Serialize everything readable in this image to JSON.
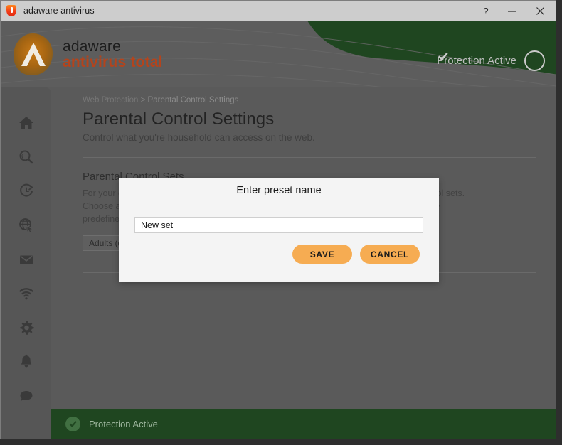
{
  "window": {
    "title": "adaware antivirus",
    "app_icon": "shield-icon",
    "controls": [
      {
        "name": "help-button",
        "glyph": "?"
      },
      {
        "name": "minimize-button",
        "glyph": "—"
      },
      {
        "name": "close-button",
        "glyph": "✕"
      }
    ]
  },
  "header": {
    "logo_top": "adaware",
    "logo_bottom": "antivirus total",
    "protection_label": "Protection Active",
    "protection_icon": "check-circle-icon",
    "green": "#1f4620"
  },
  "sidebar": {
    "items": [
      {
        "name": "sidebar-item-home",
        "icon": "home-icon"
      },
      {
        "name": "sidebar-item-scan",
        "icon": "search-icon"
      },
      {
        "name": "sidebar-item-history",
        "icon": "clock-history-icon"
      },
      {
        "name": "sidebar-item-web-protection",
        "icon": "globe-cursor-icon"
      },
      {
        "name": "sidebar-item-email",
        "icon": "envelope-icon"
      },
      {
        "name": "sidebar-item-network",
        "icon": "wifi-icon"
      },
      {
        "name": "sidebar-item-settings",
        "icon": "gear-icon"
      },
      {
        "name": "sidebar-item-notifications",
        "icon": "bell-icon"
      },
      {
        "name": "sidebar-item-support",
        "icon": "chat-bubble-icon"
      }
    ]
  },
  "breadcrumb": {
    "parent": "Web Protection",
    "separator": ">",
    "current": "Parental Control Settings"
  },
  "page": {
    "title": "Parental Control Settings",
    "subtitle": "Control what you're household can access on the web.",
    "section_title": "Parental Control Sets",
    "section_body": "For your convenience, website categories have been grouped into separate parental control sets. Choose a parental control set below. In addition, you can create your own set based on the predefined ones.",
    "preset_selected": "Adults (default)"
  },
  "modal": {
    "title": "Enter preset name",
    "input_value": "New set",
    "input_placeholder": "",
    "save_label": "SAVE",
    "cancel_label": "CANCEL",
    "button_color": "#f6ac52"
  },
  "statusbar": {
    "label": "Protection Active",
    "icon": "check-circle-filled-icon"
  }
}
